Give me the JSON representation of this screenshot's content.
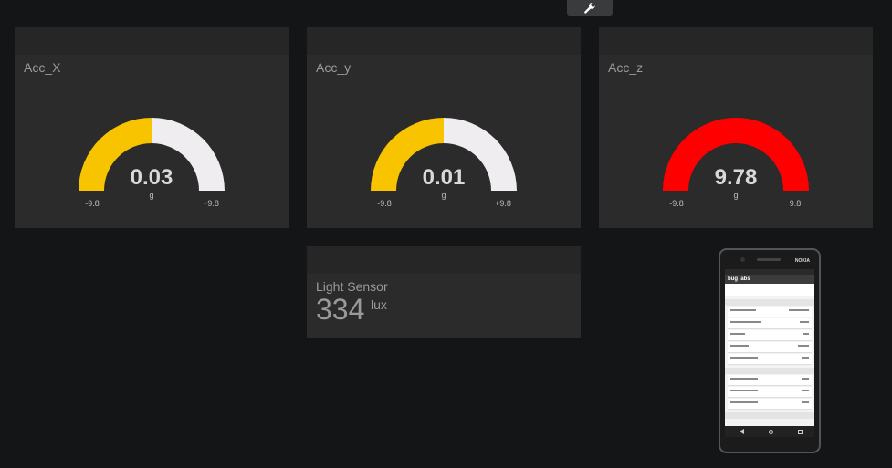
{
  "toolbar": {
    "edit_icon": "wrench-icon"
  },
  "gauges": [
    {
      "title": "Acc_X",
      "value": "0.03",
      "unit": "g",
      "min": "-9.8",
      "max": "+9.8",
      "fraction": 0.5,
      "color": "#f8c400"
    },
    {
      "title": "Acc_y",
      "value": "0.01",
      "unit": "g",
      "min": "-9.8",
      "max": "+9.8",
      "fraction": 0.5,
      "color": "#f8c400"
    },
    {
      "title": "Acc_z",
      "value": "9.78",
      "unit": "g",
      "min": "-9.8",
      "max": "9.8",
      "fraction": 1.0,
      "color": "#ff0000"
    }
  ],
  "light_sensor": {
    "title": "Light Sensor",
    "value": "334",
    "unit": "lux"
  },
  "phone": {
    "brand": "NOKIA",
    "app_title": "bug labs"
  },
  "colors": {
    "track": "#efedef",
    "panel": "#2b2b2b",
    "background": "#141517"
  }
}
